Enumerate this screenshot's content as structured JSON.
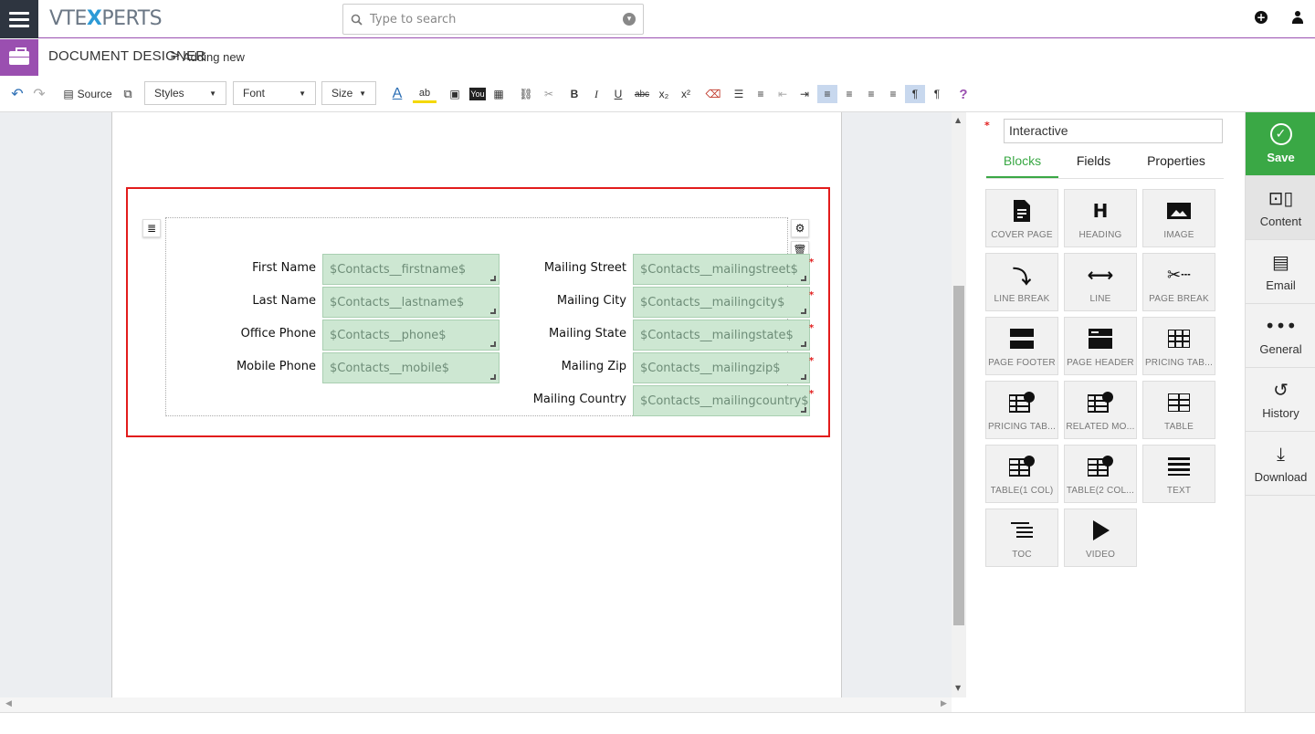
{
  "app": {
    "logo_pre": "VTE",
    "logo_x": "X",
    "logo_post": "PERTS"
  },
  "search": {
    "placeholder": "Type to search"
  },
  "breadcrumb": {
    "title": "DOCUMENT DESIGNER",
    "separator": ">",
    "current": "Adding new"
  },
  "toolbar": {
    "source_label": "Source",
    "styles_label": "Styles",
    "font_label": "Font",
    "size_label": "Size",
    "bold": "B",
    "italic": "I",
    "underline": "U",
    "strike": "abc",
    "sub": "x₂",
    "sup": "x²",
    "help": "?"
  },
  "form": {
    "left": [
      {
        "label": "First Name",
        "value": "$Contacts__firstname$"
      },
      {
        "label": "Last Name",
        "value": "$Contacts__lastname$"
      },
      {
        "label": "Office Phone",
        "value": "$Contacts__phone$"
      },
      {
        "label": "Mobile Phone",
        "value": "$Contacts__mobile$"
      }
    ],
    "right": [
      {
        "label": "Mailing Street",
        "value": "$Contacts__mailingstreet$"
      },
      {
        "label": "Mailing City",
        "value": "$Contacts__mailingcity$"
      },
      {
        "label": "Mailing State",
        "value": "$Contacts__mailingstate$"
      },
      {
        "label": "Mailing Zip",
        "value": "$Contacts__mailingzip$"
      },
      {
        "label": "Mailing Country",
        "value": "$Contacts__mailingcountry$"
      }
    ]
  },
  "panel": {
    "template_name": "Interactive",
    "required_mark": "*",
    "tabs": [
      "Blocks",
      "Fields",
      "Properties"
    ],
    "blocks": [
      {
        "label": "COVER PAGE",
        "icon": "cover-page-icon"
      },
      {
        "label": "HEADING",
        "icon": "heading-icon"
      },
      {
        "label": "IMAGE",
        "icon": "image-icon"
      },
      {
        "label": "LINE BREAK",
        "icon": "line-break-icon"
      },
      {
        "label": "LINE",
        "icon": "line-icon"
      },
      {
        "label": "PAGE BREAK",
        "icon": "page-break-icon"
      },
      {
        "label": "PAGE FOOTER",
        "icon": "page-footer-icon"
      },
      {
        "label": "PAGE HEADER",
        "icon": "page-header-icon"
      },
      {
        "label": "PRICING TAB...",
        "icon": "pricing-table-icon"
      },
      {
        "label": "PRICING TAB...",
        "icon": "pricing-table-id-icon"
      },
      {
        "label": "RELATED MO...",
        "icon": "related-module-icon"
      },
      {
        "label": "TABLE",
        "icon": "table-icon"
      },
      {
        "label": "TABLE(1 COL)",
        "icon": "table-1-col-icon"
      },
      {
        "label": "TABLE(2 COL...",
        "icon": "table-2-col-icon"
      },
      {
        "label": "TEXT",
        "icon": "text-icon"
      },
      {
        "label": "TOC",
        "icon": "toc-icon"
      },
      {
        "label": "VIDEO",
        "icon": "video-icon"
      }
    ]
  },
  "side": {
    "save": "Save",
    "content": "Content",
    "email": "Email",
    "general": "General",
    "history": "History",
    "download": "Download"
  },
  "colors": {
    "accent": "#3aa845",
    "brand": "#9a4fb0",
    "required": "#e21c1c",
    "field_bg": "#cde7d2"
  }
}
